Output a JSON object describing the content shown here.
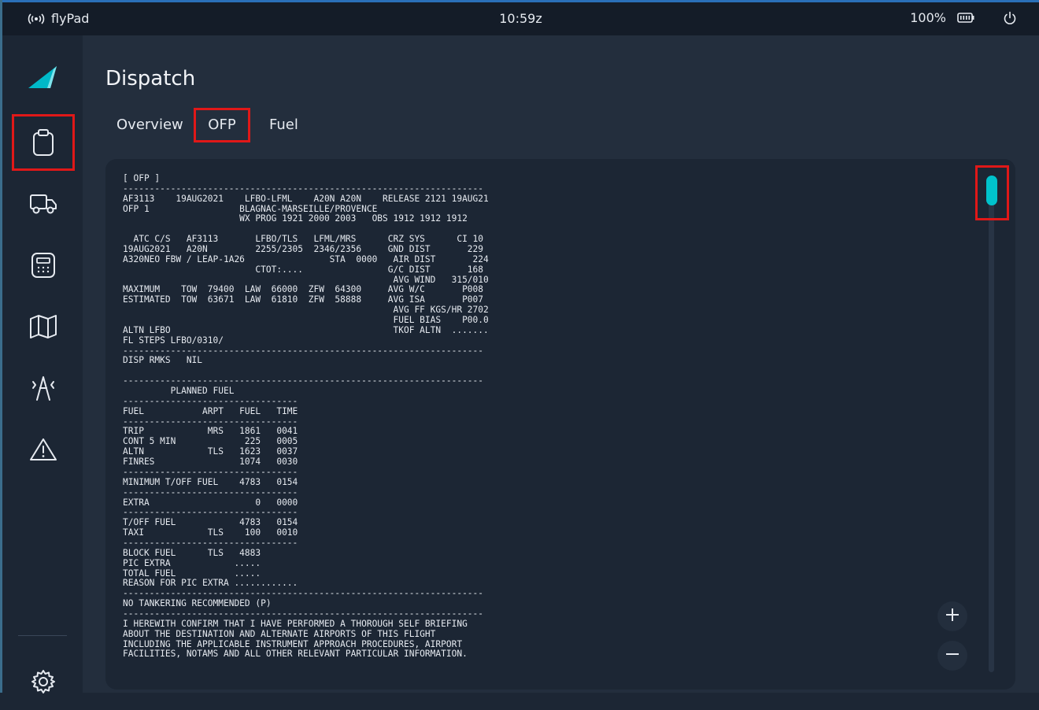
{
  "statusbar": {
    "app_name": "flyPad",
    "time": "10:59z",
    "battery": "100%",
    "icons": [
      "wireless-icon",
      "battery-icon",
      "power-icon"
    ]
  },
  "sidebar": {
    "logo": "flypad-logo",
    "items": [
      {
        "name": "dispatch",
        "icon": "clipboard-icon",
        "active": true
      },
      {
        "name": "ground",
        "icon": "truck-icon"
      },
      {
        "name": "performance",
        "icon": "calculator-icon"
      },
      {
        "name": "navigation",
        "icon": "map-icon"
      },
      {
        "name": "atc",
        "icon": "antenna-icon"
      },
      {
        "name": "failures",
        "icon": "warning-icon"
      }
    ],
    "settings": "gear-icon"
  },
  "page": {
    "title": "Dispatch",
    "tabs": [
      {
        "label": "Overview"
      },
      {
        "label": "OFP",
        "selected": true
      },
      {
        "label": "Fuel"
      }
    ]
  },
  "ofp": {
    "lines": [
      "[ OFP ]",
      "--------------------------------------------------------------------",
      "AF3113    19AUG2021    LFBO-LFML    A20N A20N    RELEASE 2121 19AUG21",
      "OFP 1                 BLAGNAC-MARSEILLE/PROVENCE",
      "                      WX PROG 1921 2000 2003   OBS 1912 1912 1912",
      "",
      "  ATC C/S   AF3113       LFBO/TLS   LFML/MRS      CRZ SYS      CI 10",
      "19AUG2021   A20N         2255/2305  2346/2356     GND DIST       229",
      "A320NEO FBW / LEAP-1A26                STA  0000   AIR DIST       224",
      "                         CTOT:....                G/C DIST       168",
      "                                                   AVG WIND   315/010",
      "MAXIMUM    TOW  79400  LAW  66000  ZFW  64300     AVG W/C       P008",
      "ESTIMATED  TOW  63671  LAW  61810  ZFW  58888     AVG ISA       P007",
      "                                                   AVG FF KGS/HR 2702",
      "                                                   FUEL BIAS    P00.0",
      "ALTN LFBO                                          TKOF ALTN  .......",
      "FL STEPS LFBO/0310/",
      "--------------------------------------------------------------------",
      "DISP RMKS   NIL",
      "",
      "--------------------------------------------------------------------",
      "         PLANNED FUEL",
      "---------------------------------",
      "FUEL           ARPT   FUEL   TIME",
      "---------------------------------",
      "TRIP            MRS   1861   0041",
      "CONT 5 MIN             225   0005",
      "ALTN            TLS   1623   0037",
      "FINRES                1074   0030",
      "---------------------------------",
      "MINIMUM T/OFF FUEL    4783   0154",
      "---------------------------------",
      "EXTRA                    0   0000",
      "---------------------------------",
      "T/OFF FUEL            4783   0154",
      "TAXI            TLS    100   0010",
      "---------------------------------",
      "BLOCK FUEL      TLS   4883",
      "PIC EXTRA            .....",
      "TOTAL FUEL           .....",
      "REASON FOR PIC EXTRA ............",
      "--------------------------------------------------------------------",
      "NO TANKERING RECOMMENDED (P)",
      "--------------------------------------------------------------------",
      "I HEREWITH CONFIRM THAT I HAVE PERFORMED A THOROUGH SELF BRIEFING",
      "ABOUT THE DESTINATION AND ALTERNATE AIRPORTS OF THIS FLIGHT",
      "INCLUDING THE APPLICABLE INSTRUMENT APPROACH PROCEDURES, AIRPORT",
      "FACILITIES, NOTAMS AND ALL OTHER RELEVANT PARTICULAR INFORMATION."
    ],
    "zoom_in": "+",
    "zoom_out": "−"
  },
  "colors": {
    "accent": "#00c2cc",
    "highlight": "#e01818",
    "background": "#1c2634",
    "panel": "#232e3d"
  }
}
